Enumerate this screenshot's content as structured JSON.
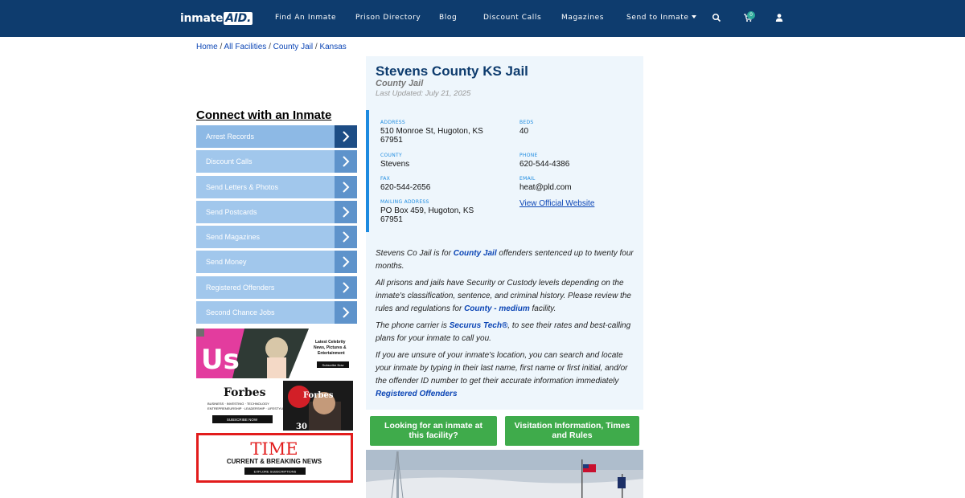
{
  "nav": {
    "logo_main": "inmate",
    "logo_suffix": "AID.",
    "links": [
      "Find An Inmate",
      "Prison Directory",
      "Blog",
      "Discount Calls",
      "Magazines",
      "Send to Inmate"
    ],
    "cart_count": "0",
    "icons": [
      "search-icon",
      "cart-icon",
      "user-icon"
    ]
  },
  "breadcrumb": {
    "items": [
      "Home",
      "All Facilities",
      "County Jail",
      "Kansas"
    ],
    "separator": "/"
  },
  "sidebar": {
    "title": "Connect with an Inmate",
    "items": [
      {
        "label": "Arrest Records"
      },
      {
        "label": "Discount Calls"
      },
      {
        "label": "Send Letters & Photos"
      },
      {
        "label": "Send Postcards"
      },
      {
        "label": "Send Magazines"
      },
      {
        "label": "Send Money"
      },
      {
        "label": "Registered Offenders"
      },
      {
        "label": "Second Chance Jobs"
      }
    ]
  },
  "ads": {
    "us": {
      "brand": "Us",
      "tagline1": "Latest Celebrity",
      "tagline2": "News, Pictures &",
      "tagline3": "Entertainment",
      "cta": "Subscribe Now"
    },
    "forbes": {
      "brand": "Forbes",
      "line1": "BUSINESS · INVESTING · TECHNOLOGY",
      "line2": "ENTREPRENEURSHIP · LEADERSHIP · LIFESTYLE",
      "cta": "SUBSCRIBE NOW",
      "cover_brand": "Forbes",
      "cover_num": "30"
    },
    "time": {
      "brand": "TIME",
      "tagline": "CURRENT & BREAKING NEWS",
      "cta": "EXPLORE SUBSCRIPTIONS"
    }
  },
  "facility": {
    "title": "Stevens County KS Jail",
    "type": "County Jail",
    "updated": "Last Updated: July 21, 2025",
    "address_label": "ADDRESS",
    "address_line1": "510 Monroe St, Hugoton, KS",
    "address_line2": "67951",
    "beds_label": "BEDS",
    "beds": "40",
    "county_label": "COUNTY",
    "county": "Stevens",
    "phone_label": "PHONE",
    "phone": "620-544-4386",
    "fax_label": "FAX",
    "fax": "620-544-2656",
    "email_label": "EMAIL",
    "email": "heat@pld.com",
    "mailing_label": "MAILING ADDRESS",
    "mailing_line1": "PO Box 459, Hugoton, KS",
    "mailing_line2": "67951",
    "website_link": "View Official Website"
  },
  "description": {
    "p1_pre": "Stevens Co Jail is for ",
    "p1_link": "County Jail",
    "p1_post": " offenders sentenced up to twenty four months.",
    "p2_pre": "All prisons and jails have Security or Custody levels depending on the inmate's classification, sentence, and criminal history. Please review the rules and regulations for ",
    "p2_link": "County - medium",
    "p2_post": " facility.",
    "p3_pre": "The phone carrier is ",
    "p3_link": "Securus Tech®",
    "p3_post": ", to see their rates and best-calling plans for your inmate to call you.",
    "p4_pre": "If you are unsure of your inmate's location, you can search and locate your inmate by typing in their last name, first name or first initial, and/or the offender ID number to get their accurate information immediately ",
    "p4_link": "Registered Offenders"
  },
  "buttons": {
    "find_inmate": "Looking for an inmate at this facility?",
    "visitation": "Visitation Information, Times and Rules"
  },
  "colors": {
    "navbar": "#0e3c6e",
    "menu_item": "#a1c7ec",
    "menu_arrow": "#5e93cb",
    "menu_arrow_active": "#1d4d85",
    "card_bg": "#eef6fc",
    "accent_blue": "#1d8be0",
    "link": "#0b45b5",
    "green_button": "#3fab4b",
    "time_red": "#e21c1c"
  }
}
